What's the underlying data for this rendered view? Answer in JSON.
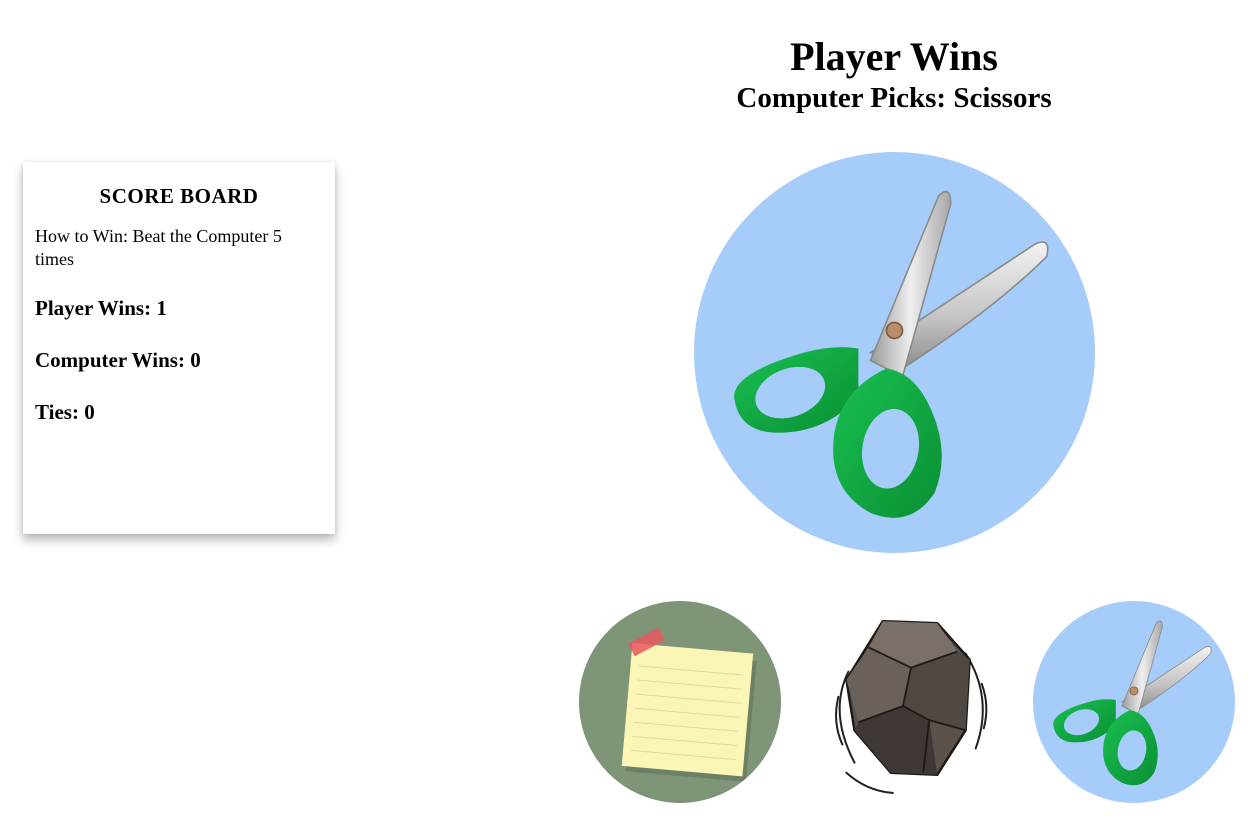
{
  "scoreboard": {
    "title": "SCORE BOARD",
    "how_to_win": "How to Win: Beat the Computer 5 times",
    "player_wins": "Player Wins: 1",
    "computer_wins": "Computer Wins: 0",
    "ties": "Ties: 0"
  },
  "result": {
    "title": "Player Wins",
    "computer_pick": "Computer Picks: Scissors"
  },
  "computer_choice": {
    "icon": "scissors-icon",
    "background": "#a6cdfa"
  },
  "choices": [
    {
      "name": "paper",
      "icon": "paper-icon",
      "background": "#7f9577"
    },
    {
      "name": "rock",
      "icon": "rock-icon",
      "background": "#ffffff"
    },
    {
      "name": "scissors",
      "icon": "scissors-icon",
      "background": "#a6cdfa"
    }
  ],
  "colors": {
    "scissors_handle": "#11a83f",
    "scissors_blade": "#c9c9c9",
    "rock": "#5b524c",
    "paper_note": "#fbf5b6",
    "paper_tape": "#e8585f"
  }
}
